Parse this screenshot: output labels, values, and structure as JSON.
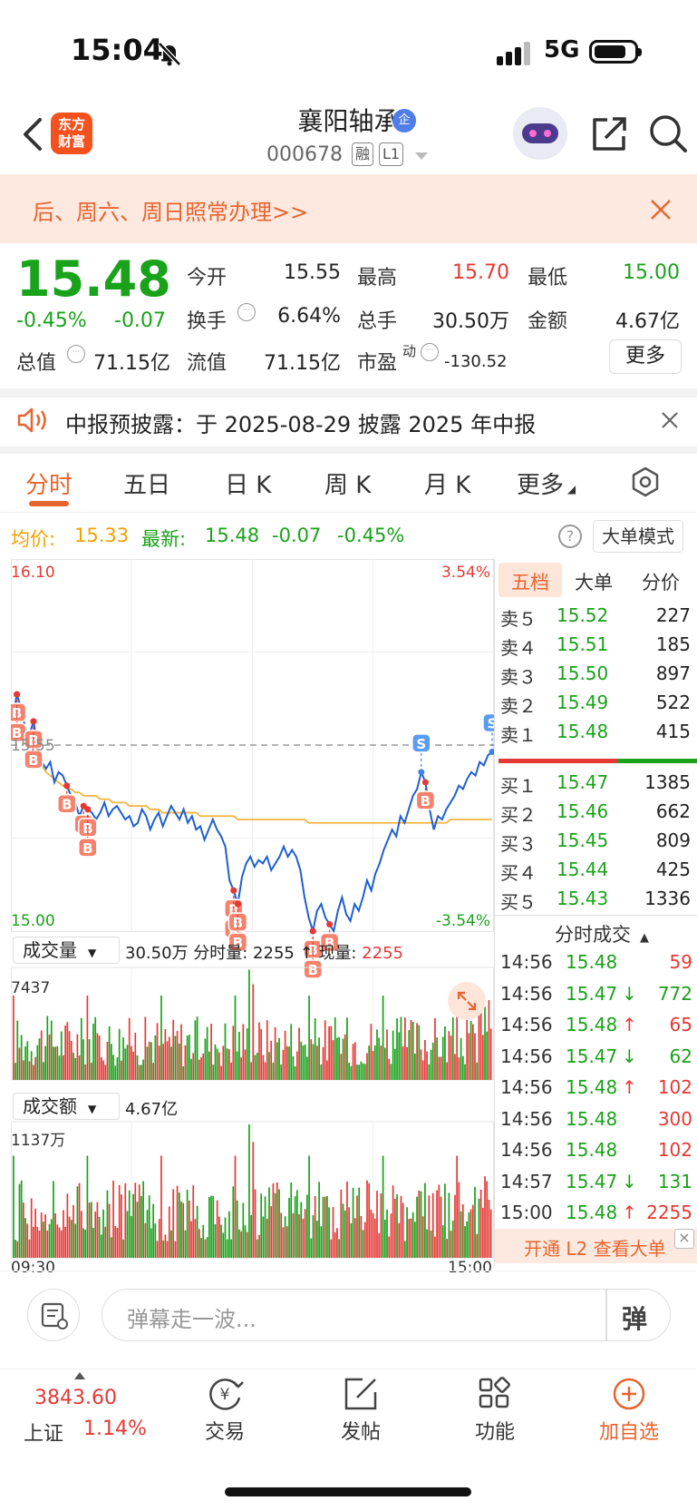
{
  "status": {
    "time": "15:04",
    "network": "5G"
  },
  "header": {
    "logo_line1": "东方",
    "logo_line2": "财富",
    "name": "襄阳轴承",
    "badge": "企",
    "code": "000678",
    "tag1": "融",
    "tag2": "L1"
  },
  "banner": {
    "text": "后、周六、周日照常办理>>"
  },
  "quote": {
    "price": "15.48",
    "change_pct": "-0.45%",
    "change": "-0.07",
    "open_label": "今开",
    "open": "15.55",
    "high_label": "最高",
    "high": "15.70",
    "low_label": "最低",
    "low": "15.00",
    "turnover_label": "换手",
    "turnover": "6.64%",
    "volume_label": "总手",
    "volume": "30.50万",
    "amount_label": "金额",
    "amount": "4.67亿",
    "mcap_label": "总值",
    "mcap": "71.15亿",
    "float_label": "流值",
    "float": "71.15亿",
    "pe_label": "市盈",
    "pe_sup": "动",
    "pe": "-130.52",
    "more": "更多"
  },
  "notice": {
    "text": "中报预披露：于 2025-08-29 披露 2025 年中报"
  },
  "tabs": [
    "分时",
    "五日",
    "日 K",
    "周 K",
    "月 K",
    "更多"
  ],
  "avgline": {
    "avg_label": "均价:",
    "avg": "15.33",
    "latest_label": "最新:",
    "latest": "15.48",
    "chg": "-0.07",
    "pct": "-0.45%",
    "help": "?",
    "big_mode": "大单模式"
  },
  "chart_data": {
    "type": "line",
    "price_top": "16.10",
    "price_bottom": "15.00",
    "pct_top": "3.54%",
    "pct_bottom": "-3.54%",
    "prev_close_label": "15.55",
    "x_start": "09:30",
    "x_end": "15:00",
    "ylim": [
      15.0,
      16.1
    ],
    "prev_close": 15.55,
    "colors": {
      "price": "#1f5fcf",
      "avg": "#f4b43c",
      "up": "#e53935",
      "down": "#1aa21a"
    },
    "price_series": [
      15.63,
      15.7,
      15.66,
      15.6,
      15.58,
      15.62,
      15.55,
      15.5,
      15.48,
      15.5,
      15.44,
      15.47,
      15.46,
      15.43,
      15.4,
      15.38,
      15.34,
      15.37,
      15.36,
      15.35,
      15.33,
      15.35,
      15.38,
      15.34,
      15.36,
      15.37,
      15.35,
      15.33,
      15.34,
      15.31,
      15.32,
      15.36,
      15.34,
      15.3,
      15.33,
      15.35,
      15.31,
      15.34,
      15.37,
      15.35,
      15.33,
      15.36,
      15.32,
      15.34,
      15.3,
      15.31,
      15.27,
      15.3,
      15.33,
      15.3,
      15.28,
      15.25,
      15.15,
      15.12,
      15.08,
      15.16,
      15.2,
      15.22,
      15.19,
      15.21,
      15.2,
      15.22,
      15.18,
      15.2,
      15.22,
      15.25,
      15.22,
      15.24,
      15.22,
      15.18,
      15.1,
      15.04,
      15.0,
      15.06,
      15.08,
      15.04,
      15.02,
      15.0,
      15.06,
      15.1,
      15.05,
      15.03,
      15.08,
      15.06,
      15.1,
      15.15,
      15.12,
      15.17,
      15.2,
      15.24,
      15.27,
      15.3,
      15.28,
      15.34,
      15.32,
      15.36,
      15.4,
      15.42,
      15.47,
      15.44,
      15.36,
      15.3,
      15.34,
      15.33,
      15.36,
      15.38,
      15.4,
      15.43,
      15.42,
      15.45,
      15.47,
      15.46,
      15.5,
      15.49,
      15.52,
      15.53
    ],
    "avg_series": [
      15.58,
      15.6,
      15.59,
      15.57,
      15.55,
      15.53,
      15.5,
      15.49,
      15.47,
      15.46,
      15.45,
      15.44,
      15.43,
      15.42,
      15.42,
      15.41,
      15.41,
      15.4,
      15.4,
      15.4,
      15.4,
      15.39,
      15.39,
      15.39,
      15.38,
      15.38,
      15.38,
      15.38,
      15.37,
      15.37,
      15.37,
      15.37,
      15.37,
      15.36,
      15.36,
      15.36,
      15.35,
      15.35,
      15.35,
      15.35,
      15.35,
      15.35,
      15.35,
      15.35,
      15.35,
      15.34,
      15.34,
      15.34,
      15.34,
      15.34,
      15.34,
      15.34,
      15.34,
      15.34,
      15.33,
      15.33,
      15.33,
      15.33,
      15.33,
      15.33,
      15.33,
      15.33,
      15.33,
      15.33,
      15.33,
      15.33,
      15.33,
      15.33,
      15.33,
      15.33,
      15.33,
      15.32,
      15.32,
      15.32,
      15.32,
      15.32,
      15.32,
      15.32,
      15.32,
      15.32,
      15.32,
      15.32,
      15.32,
      15.32,
      15.32,
      15.32,
      15.32,
      15.32,
      15.32,
      15.32,
      15.32,
      15.32,
      15.32,
      15.32,
      15.32,
      15.32,
      15.32,
      15.32,
      15.32,
      15.32,
      15.32,
      15.32,
      15.32,
      15.32,
      15.32,
      15.33,
      15.33,
      15.33,
      15.33,
      15.33,
      15.33,
      15.33,
      15.33,
      15.33,
      15.33,
      15.33
    ],
    "volume_label": "成交量",
    "volume_info": "30.50万 分时量: 2255 ↑ 现量:",
    "volume_now": "2255",
    "volume_max": "7437",
    "amount_label": "成交额",
    "amount_info": "4.67亿",
    "amount_max": "1137万",
    "signals": [
      {
        "label": "B",
        "i": 1
      },
      {
        "label": "B",
        "i": 1
      },
      {
        "label": "B",
        "i": 5
      },
      {
        "label": "B",
        "i": 5
      },
      {
        "label": "B",
        "i": 13
      },
      {
        "label": "B",
        "i": 17
      },
      {
        "label": "B",
        "i": 18
      },
      {
        "label": "B",
        "i": 18
      },
      {
        "label": "B",
        "i": 53
      },
      {
        "label": "B",
        "i": 53
      },
      {
        "label": "B",
        "i": 54
      },
      {
        "label": "B",
        "i": 54
      },
      {
        "label": "B",
        "i": 72
      },
      {
        "label": "B",
        "i": 72
      },
      {
        "label": "B",
        "i": 76
      },
      {
        "label": "B",
        "i": 99
      },
      {
        "label": "S",
        "i": 98
      },
      {
        "label": "S",
        "i": 115
      }
    ]
  },
  "orderbook": {
    "tabs": [
      "五档",
      "大单",
      "分价"
    ],
    "sells": [
      {
        "label": "卖５",
        "price": "15.52",
        "vol": "227"
      },
      {
        "label": "卖４",
        "price": "15.51",
        "vol": "185"
      },
      {
        "label": "卖３",
        "price": "15.50",
        "vol": "897"
      },
      {
        "label": "卖２",
        "price": "15.49",
        "vol": "522"
      },
      {
        "label": "卖１",
        "price": "15.48",
        "vol": "415"
      }
    ],
    "buys": [
      {
        "label": "买１",
        "price": "15.47",
        "vol": "1385"
      },
      {
        "label": "买２",
        "price": "15.46",
        "vol": "662"
      },
      {
        "label": "买３",
        "price": "15.45",
        "vol": "809"
      },
      {
        "label": "买４",
        "price": "15.44",
        "vol": "425"
      },
      {
        "label": "买５",
        "price": "15.43",
        "vol": "1336"
      }
    ],
    "sell_ratio": 0.6
  },
  "ticks": {
    "title": "分时成交",
    "rows": [
      {
        "time": "14:56",
        "price": "15.48",
        "arrow": "",
        "vol": "59",
        "dir": "up"
      },
      {
        "time": "14:56",
        "price": "15.47",
        "arrow": "↓",
        "vol": "772",
        "dir": "down"
      },
      {
        "time": "14:56",
        "price": "15.48",
        "arrow": "↑",
        "vol": "65",
        "dir": "up"
      },
      {
        "time": "14:56",
        "price": "15.47",
        "arrow": "↓",
        "vol": "62",
        "dir": "down"
      },
      {
        "time": "14:56",
        "price": "15.48",
        "arrow": "↑",
        "vol": "102",
        "dir": "up"
      },
      {
        "time": "14:56",
        "price": "15.48",
        "arrow": "",
        "vol": "300",
        "dir": "up"
      },
      {
        "time": "14:56",
        "price": "15.48",
        "arrow": "",
        "vol": "102",
        "dir": "up"
      },
      {
        "time": "14:57",
        "price": "15.47",
        "arrow": "↓",
        "vol": "131",
        "dir": "down"
      },
      {
        "time": "15:00",
        "price": "15.48",
        "arrow": "↑",
        "vol": "2255",
        "dir": "up"
      }
    ],
    "l2": "开通 L2 查看大单",
    "l2_close": "×"
  },
  "barrage": {
    "placeholder": "弹幕走一波...",
    "send": "弹"
  },
  "bottom": {
    "index_value": "3843.60",
    "index_name": "上证",
    "index_pct": "1.14%",
    "items": [
      "交易",
      "发帖",
      "功能",
      "加自选"
    ]
  }
}
